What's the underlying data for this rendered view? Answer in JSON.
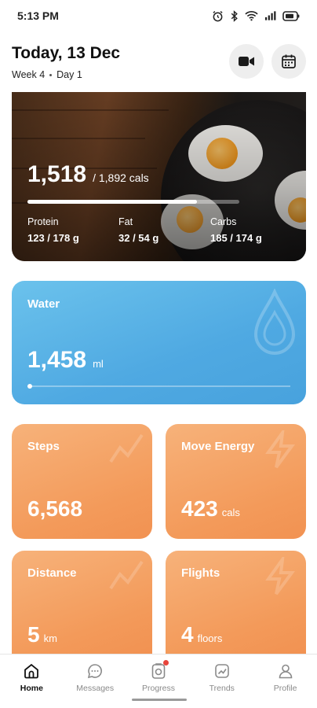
{
  "status_bar": {
    "time": "5:13 PM",
    "battery_icon": "battery-icon"
  },
  "header": {
    "title": "Today, 13 Dec",
    "week": "Week 4",
    "day": "Day 1",
    "buttons": [
      "video-icon",
      "calendar-icon"
    ]
  },
  "food": {
    "calories": "1,518",
    "calories_total": "/ 1,892 cals",
    "calorie_progress": 0.8,
    "macros": [
      {
        "name": "Protein",
        "value": "123 / 178 g"
      },
      {
        "name": "Fat",
        "value": "32 / 54 g"
      },
      {
        "name": "Carbs",
        "value": "185 / 174 g"
      }
    ]
  },
  "water": {
    "title": "Water",
    "value": "1,458",
    "unit": "ml",
    "progress": 0.0
  },
  "tiles": [
    {
      "title": "Steps",
      "value": "6,568",
      "unit": ""
    },
    {
      "title": "Move Energy",
      "value": "423",
      "unit": "cals"
    },
    {
      "title": "Distance",
      "value": "5",
      "unit": "km"
    },
    {
      "title": "Flights",
      "value": "4",
      "unit": "floors"
    }
  ],
  "nav": [
    {
      "label": "Home",
      "icon": "home-icon",
      "active": true
    },
    {
      "label": "Messages",
      "icon": "chat-icon",
      "active": false
    },
    {
      "label": "Progress",
      "icon": "progress-icon",
      "active": false,
      "badge": true
    },
    {
      "label": "Trends",
      "icon": "trends-icon",
      "active": false
    },
    {
      "label": "Profile",
      "icon": "profile-icon",
      "active": false
    }
  ],
  "colors": {
    "water": "#4fa9e2",
    "activity": "#f39a5a",
    "badge": "#e8453c"
  }
}
